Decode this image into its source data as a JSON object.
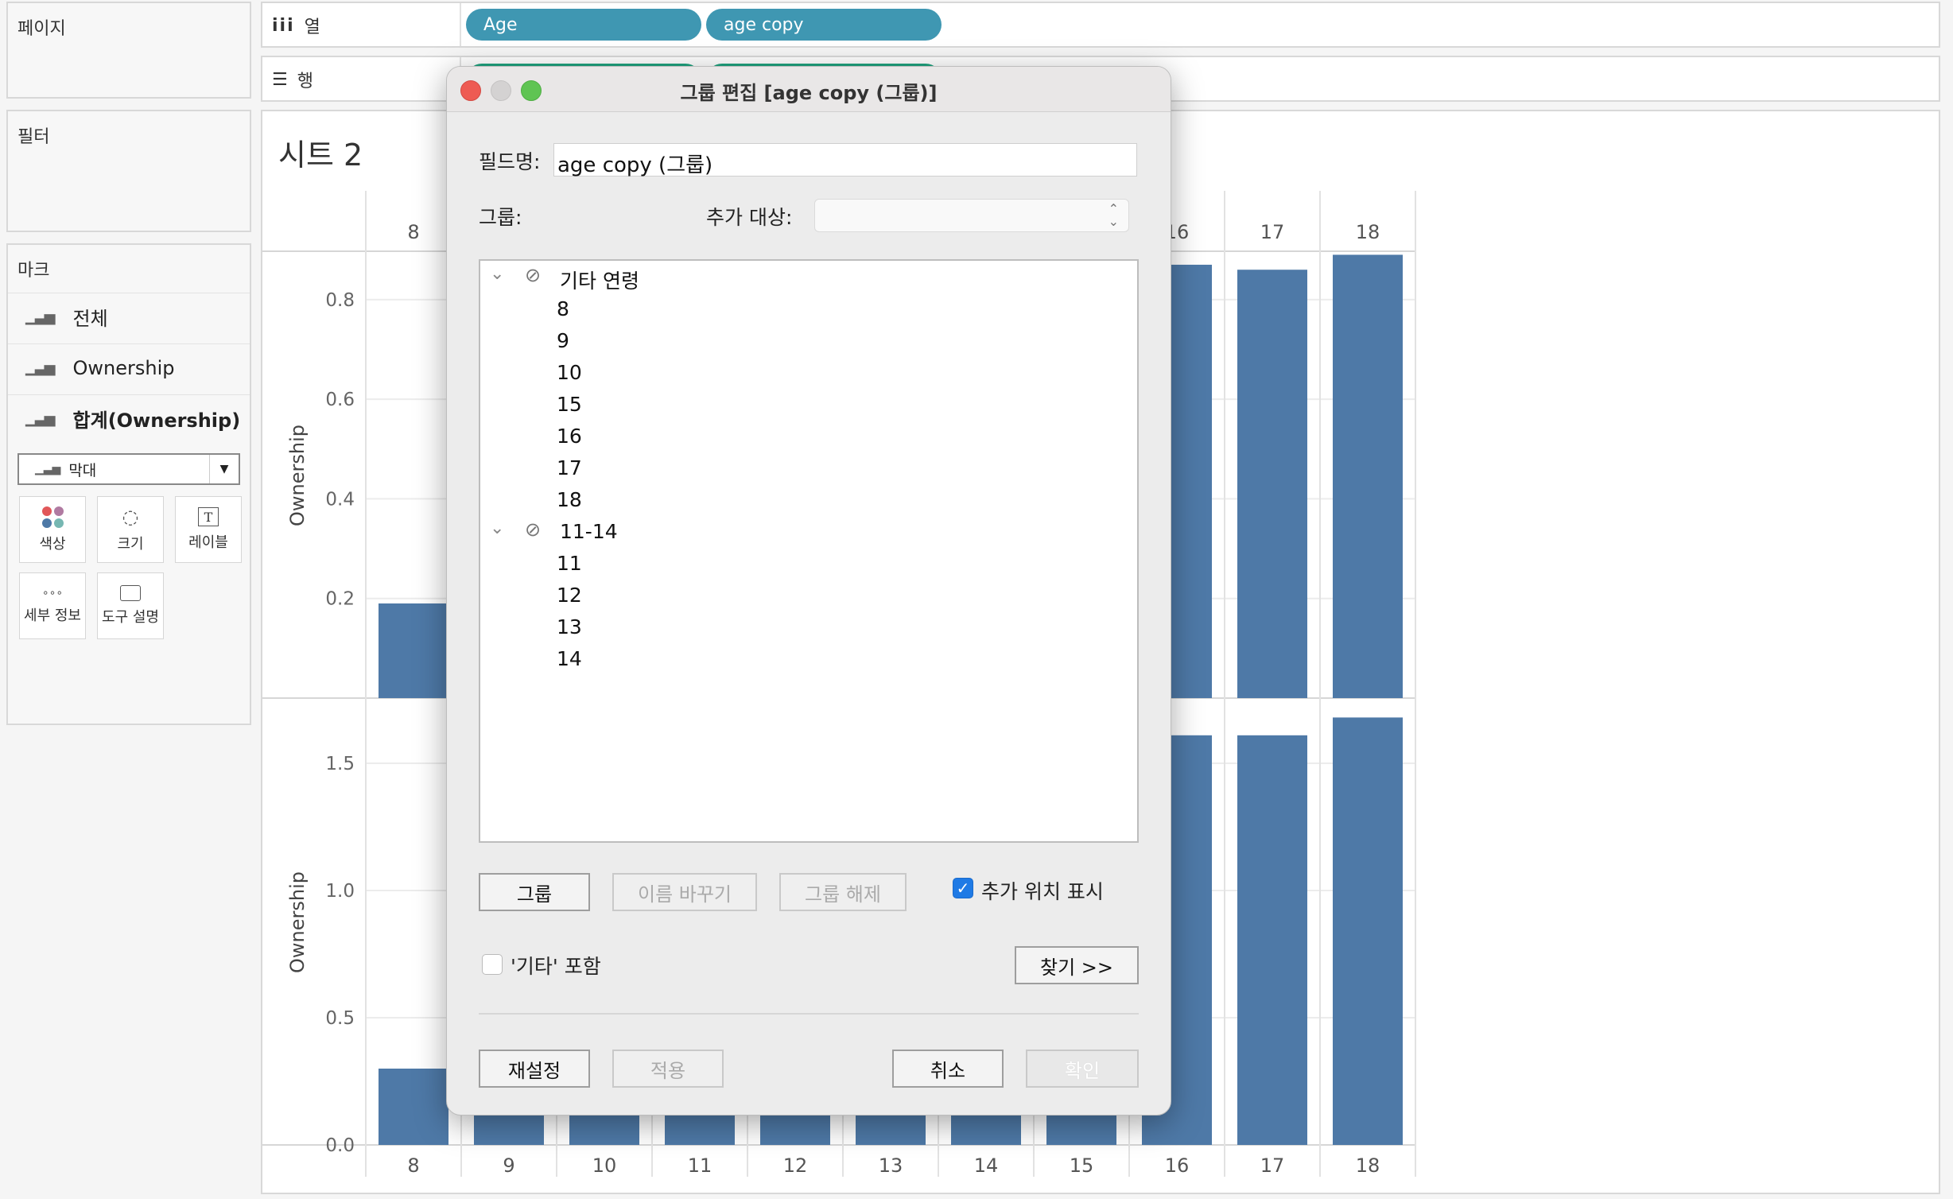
{
  "left": {
    "pages_title": "페이지",
    "filters_title": "필터",
    "marks_title": "마크",
    "mark_rows": [
      "전체",
      "Ownership",
      "합계(Ownership)"
    ],
    "mark_type": "막대",
    "mark_buttons": [
      "색상",
      "크기",
      "레이블",
      "세부 정보",
      "도구 설명"
    ]
  },
  "shelves": {
    "columns_label": "열",
    "rows_label": "행",
    "column_pills": [
      "Age",
      "age copy"
    ]
  },
  "sheet": {
    "title": "시트 2",
    "y_label_top": "Ownership",
    "y_label_bottom": "Ownership"
  },
  "chart_data": {
    "type": "bar",
    "categories": [
      "8",
      "9",
      "10",
      "11",
      "12",
      "13",
      "14",
      "15",
      "16",
      "17",
      "18"
    ],
    "top_ticks": [
      "0.2",
      "0.4",
      "0.6",
      "0.8"
    ],
    "bottom_ticks": [
      "0.0",
      "0.5",
      "1.0",
      "1.5"
    ],
    "top_visible_values": {
      "8": 0.19,
      "16": 0.87,
      "17": 0.86,
      "18": 0.89
    },
    "bottom_visible_values": {
      "8": 0.3,
      "16": 1.61,
      "17": 1.61,
      "18": 1.68
    },
    "color": "#4e79a7"
  },
  "dialog": {
    "title": "그룹 편집 [age copy (그룹)]",
    "field_name_label": "필드명:",
    "field_name_value": "age copy (그룹)",
    "group_label": "그룹:",
    "add_to_label": "추가 대상:",
    "groups": [
      {
        "name": "기타 연령",
        "members": [
          "8",
          "9",
          "10",
          "15",
          "16",
          "17",
          "18"
        ]
      },
      {
        "name": "11-14",
        "members": [
          "11",
          "12",
          "13",
          "14"
        ]
      }
    ],
    "btn_group": "그룹",
    "btn_rename": "이름 바꾸기",
    "btn_ungroup": "그룹 해제",
    "show_add_location": "추가 위치 표시",
    "include_other": "'기타' 포함",
    "btn_find": "찾기 >>",
    "btn_reset": "재설정",
    "btn_apply": "적용",
    "btn_cancel": "취소",
    "btn_ok": "확인"
  }
}
